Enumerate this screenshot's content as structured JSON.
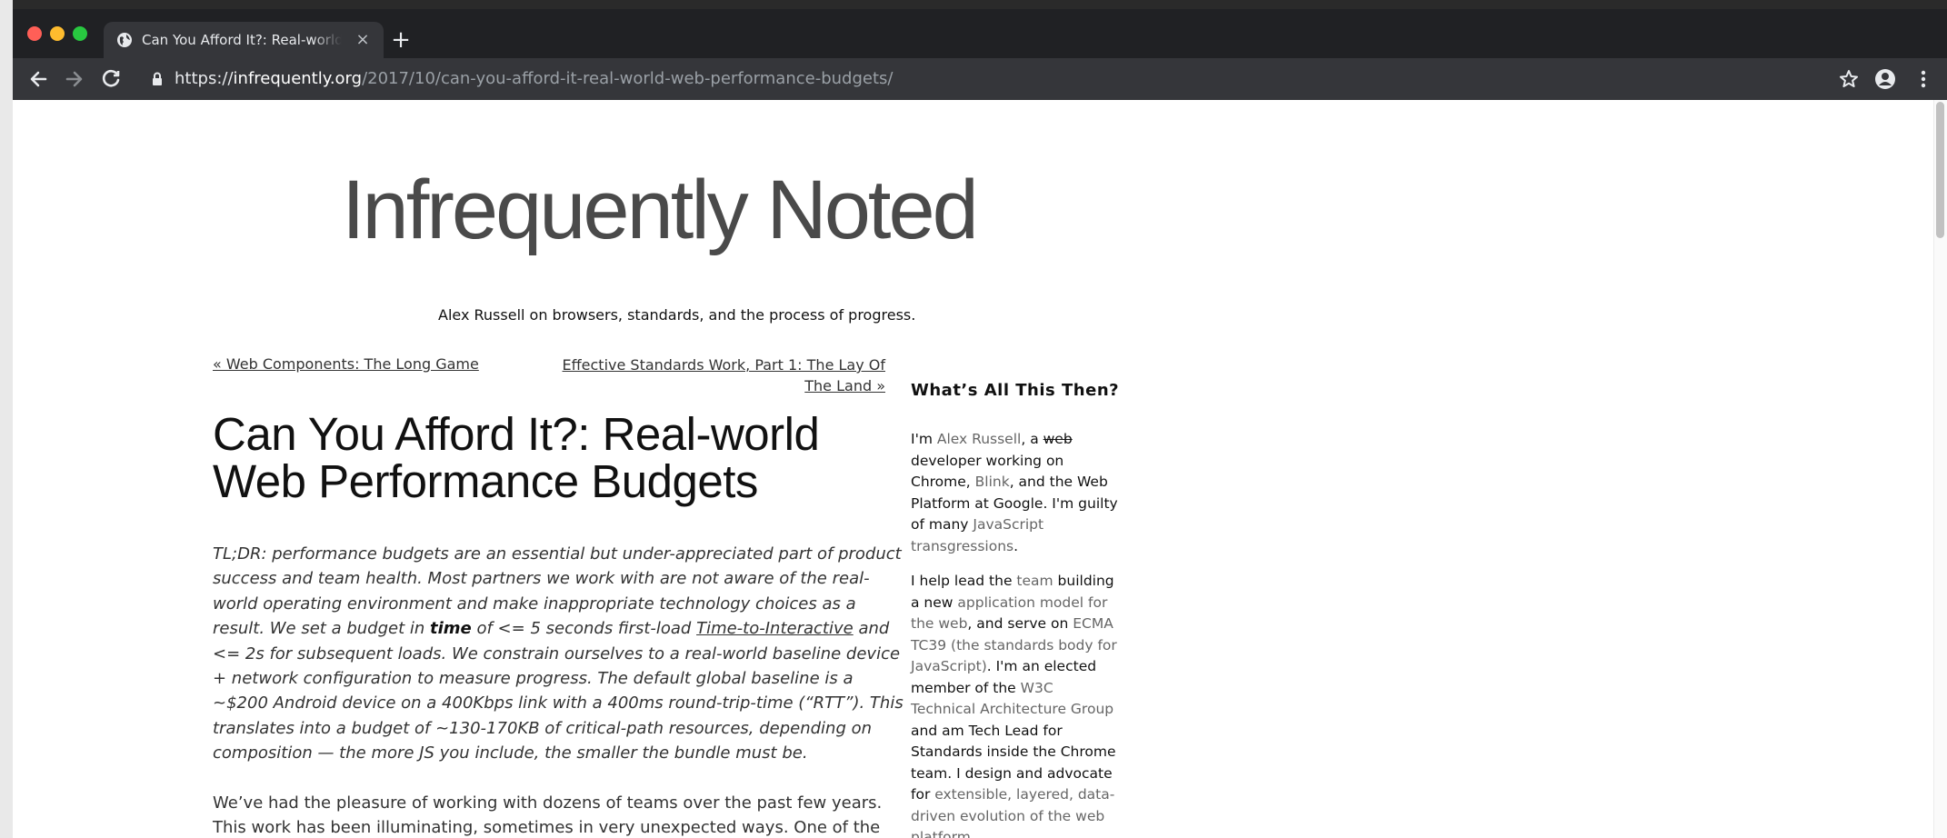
{
  "browser": {
    "tab_title": "Can You Afford It?: Real-world Web Performance Budgets",
    "close_glyph": "×",
    "new_tab_glyph": "+",
    "url_scheme": "https://",
    "url_host": "infrequently.org",
    "url_path": "/2017/10/can-you-afford-it-real-world-web-performance-budgets/"
  },
  "site": {
    "title": "Infrequently Noted",
    "tagline": "Alex Russell on browsers, standards, and the process of progress."
  },
  "post_nav": {
    "prev": "« Web Components: The Long Game",
    "next": "Effective Standards Work, Part 1: The Lay Of The Land »"
  },
  "article": {
    "title": "Can You Afford It?: Real-world Web Performance Budgets",
    "tldr_a": "TL;DR: performance budgets are an essential but under-appreciated part of product success and team health. Most partners we work with are not aware of the real-world operating environment and make inappropriate technology choices as a result. We set a budget in ",
    "tldr_bold": "time",
    "tldr_b": " of <= 5 seconds first-load ",
    "tldr_link": "Time-to-Interactive",
    "tldr_c": " and <= 2s for subsequent loads. We constrain ourselves to a real-world baseline device + network configuration to measure progress. The default global baseline is a ~$200 Android device on a 400Kbps link with a 400ms round-trip-time (“RTT”). This translates into a budget of ~130-170KB of critical-path resources, depending on composition — the more JS you include, the smaller the bundle must be.",
    "para2": "We’ve had the pleasure of working with dozens of teams over the past few years. This work has been illuminating, sometimes in very unexpected ways. One of the"
  },
  "sidebar": {
    "heading": "What’s All This Then?",
    "p1": {
      "t1": "I'm ",
      "l1": "Alex Russell",
      "t2": ", a ",
      "strike": "web",
      "t3": " developer working on Chrome, ",
      "l2": "Blink",
      "t4": ", and the Web Platform at Google. I'm guilty of many ",
      "l3": "JavaScript transgressions",
      "t5": "."
    },
    "p2": {
      "t1": "I help lead the ",
      "l1": "team",
      "t2": " building a new ",
      "l2": "application model for the web",
      "t3": ", and serve on ",
      "l3": "ECMA TC39 (the standards body for JavaScript)",
      "t4": ". I'm an elected member of the ",
      "l4": "W3C Technical Architecture Group",
      "t5": " and am Tech Lead for Standards inside the Chrome team. I design and advocate for ",
      "l5": "extensible, layered, data-driven evolution of the web platform",
      "t6": "."
    }
  },
  "icons": {
    "favicon": "globe-icon",
    "back": "back-arrow-icon",
    "forward": "forward-arrow-icon",
    "reload": "reload-icon",
    "lock": "lock-icon",
    "bookmark": "star-icon",
    "profile": "account-icon",
    "menu": "kebab-menu-icon"
  }
}
